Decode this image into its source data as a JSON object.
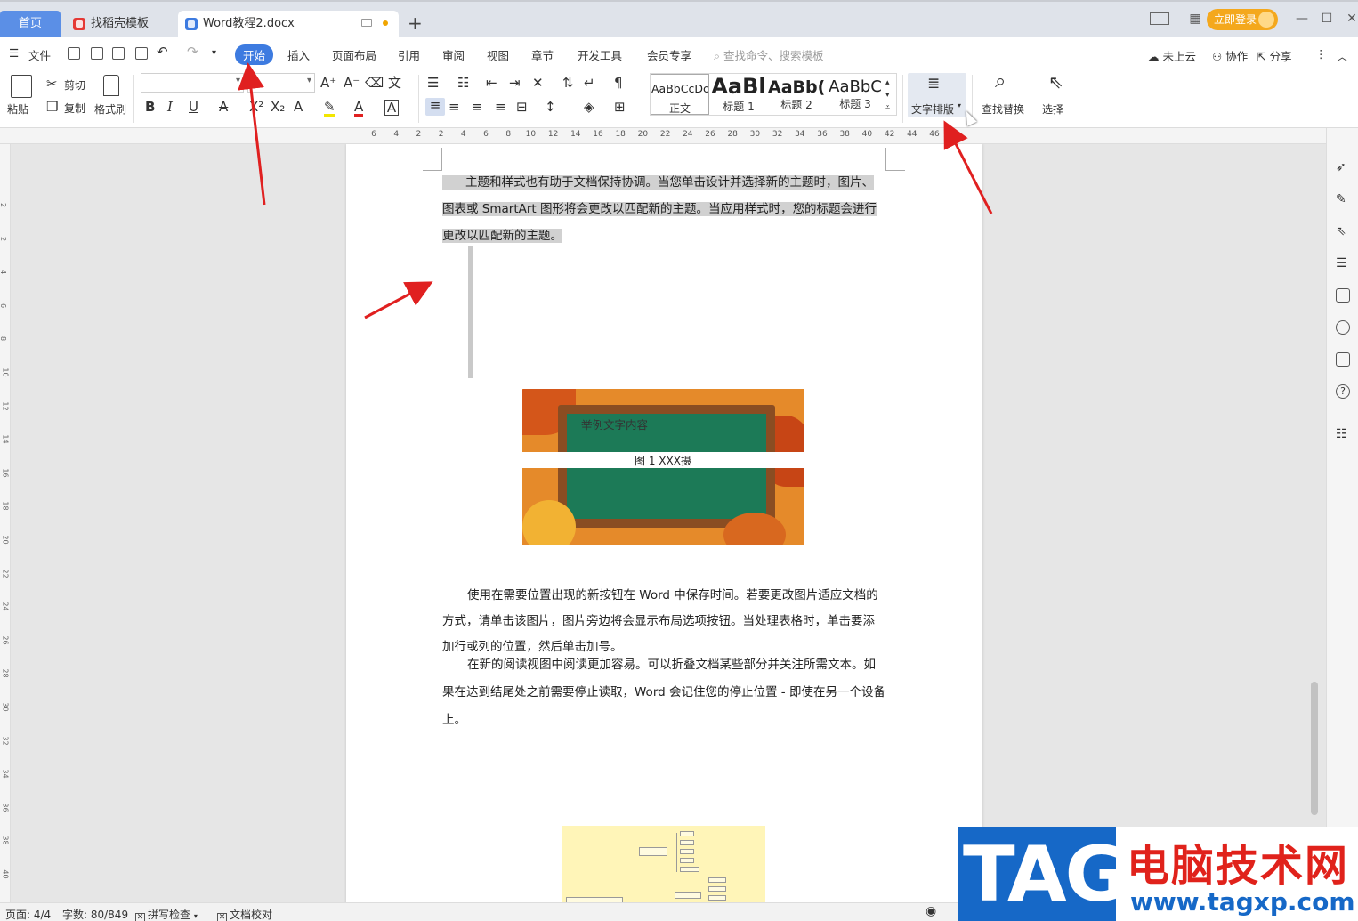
{
  "tabs": {
    "home": "首页",
    "daoke": "找稻壳模板",
    "document": "Word教程2.docx"
  },
  "window": {
    "login_label": "立即登录"
  },
  "menu": {
    "file": "文件",
    "items": [
      "开始",
      "插入",
      "页面布局",
      "引用",
      "审阅",
      "视图",
      "章节",
      "开发工具",
      "会员专享"
    ],
    "search_placeholder": "查找命令、搜索模板",
    "cloud": "未上云",
    "collab": "协作",
    "share": "分享"
  },
  "ribbon": {
    "paste": "粘贴",
    "cut": "剪切",
    "copy": "复制",
    "format_painter": "格式刷",
    "font_name": "",
    "font_size": "",
    "styles": [
      {
        "sample": "AaBbCcDc",
        "name": "正文"
      },
      {
        "sample": "AaBl",
        "name": "标题 1"
      },
      {
        "sample": "AaBb(",
        "name": "标题 2"
      },
      {
        "sample": "AaBbC",
        "name": "标题 3"
      }
    ],
    "text_layout": "文字排版",
    "find_replace": "查找替换",
    "select": "选择"
  },
  "ruler": {
    "ticks": [
      "6",
      "4",
      "2",
      "2",
      "4",
      "6",
      "8",
      "10",
      "12",
      "14",
      "16",
      "18",
      "20",
      "22",
      "24",
      "26",
      "28",
      "30",
      "32",
      "34",
      "36",
      "38",
      "40",
      "42",
      "44",
      "46"
    ],
    "vticks": [
      "2",
      "2",
      "4",
      "6",
      "8",
      "10",
      "12",
      "14",
      "16",
      "18",
      "20",
      "22",
      "24",
      "26",
      "28",
      "30",
      "32",
      "34",
      "36",
      "38",
      "40",
      "42"
    ]
  },
  "document": {
    "para1": "主题和样式也有助于文档保持协调。当您单击设计并选择新的主题时，图片、图表或 SmartArt 图形将会更改以匹配新的主题。当应用样式时，您的标题会进行更改以匹配新的主题。",
    "picture_text": "举例文字内容",
    "picture_caption": "图 1   XXX摄",
    "para2": "使用在需要位置出现的新按钮在 Word 中保存时间。若要更改图片适应文档的方式，请单击该图片，图片旁边将会显示布局选项按钮。当处理表格时，单击要添加行或列的位置，然后单击加号。",
    "para3": "在新的阅读视图中阅读更加容易。可以折叠文档某些部分并关注所需文本。如果在达到结尾处之前需要停止读取，Word 会记住您的停止位置 - 即使在另一个设备上。"
  },
  "status": {
    "page": "页面: 4/4",
    "words": "字数: 80/849",
    "spell": "拼写检查",
    "proof": "文档校对"
  },
  "watermark": {
    "tag": "TAG",
    "title": "电脑技术网",
    "url": "www.tagxp.com"
  },
  "colors": {
    "accent": "#3d7be0",
    "arrow": "#e02020",
    "login": "#f4a81d"
  }
}
